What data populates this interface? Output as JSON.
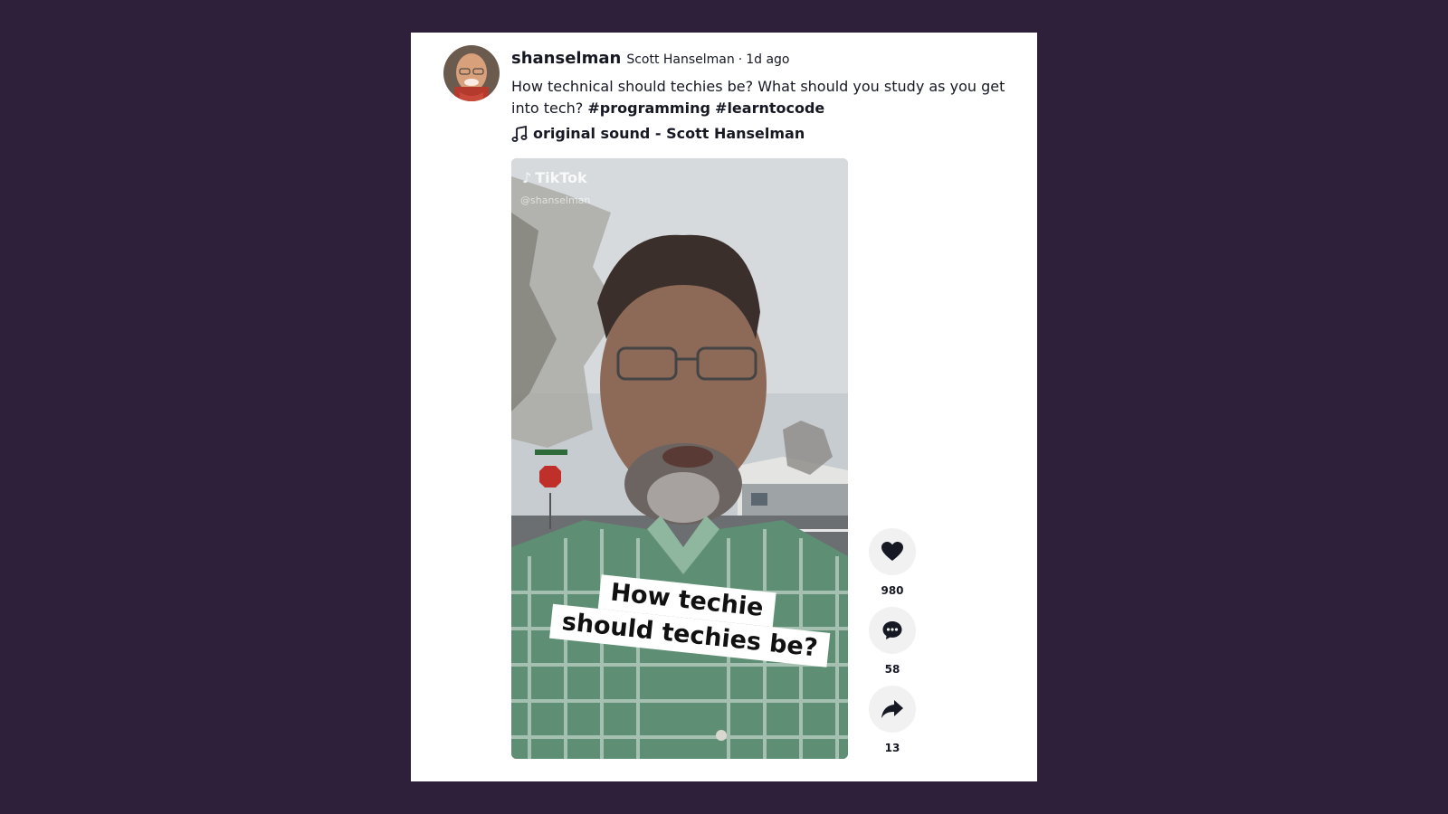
{
  "post": {
    "username": "shanselman",
    "nickname": "Scott Hanselman",
    "separator": "·",
    "time_ago": "1d ago",
    "caption_text": "How technical should techies be? What should you study as you get into tech?",
    "hashtags": [
      "#programming",
      "#learntocode"
    ],
    "sound": "original sound - Scott Hanselman"
  },
  "video": {
    "watermark": "TikTok",
    "watermark_handle": "@shanselman",
    "sticker_line1": "How techie",
    "sticker_line2": "should techies be?"
  },
  "actions": {
    "likes": "980",
    "comments": "58",
    "shares": "13"
  },
  "icons": {
    "like": "heart-icon",
    "comment": "comment-icon",
    "share": "share-icon",
    "sound": "music-note-icon"
  },
  "colors": {
    "background": "#2e1f3b",
    "card": "#ffffff",
    "text": "#161823",
    "action_bg": "#f1f1f2"
  }
}
